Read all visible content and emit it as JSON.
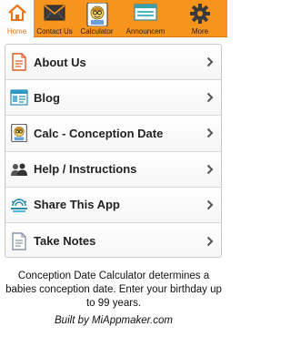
{
  "tabs": [
    {
      "label": "Home",
      "icon": "home-icon",
      "active": true
    },
    {
      "label": "Contact Us",
      "icon": "envelope-icon"
    },
    {
      "label": "Calculator",
      "icon": "calculator-icon"
    },
    {
      "label": "Announcem",
      "icon": "announcement-icon"
    },
    {
      "label": "More",
      "icon": "gear-icon"
    }
  ],
  "menu": {
    "items": [
      {
        "label": "About Us",
        "icon": "document-icon"
      },
      {
        "label": "Blog",
        "icon": "blog-icon"
      },
      {
        "label": "Calc - Conception Date",
        "icon": "calculator-icon"
      },
      {
        "label": "Help / Instructions",
        "icon": "people-icon"
      },
      {
        "label": "Share This App",
        "icon": "share-icon"
      },
      {
        "label": "Take Notes",
        "icon": "notes-icon"
      }
    ]
  },
  "footer": {
    "description": "Conception Date Calculator determines a babies conception date. Enter your birthday up to 99 years.",
    "built_by": "Built by MiAppmaker.com"
  },
  "colors": {
    "tabbar": "#f7941e",
    "active_tab_label": "#e8751a",
    "chevron": "#555555"
  }
}
